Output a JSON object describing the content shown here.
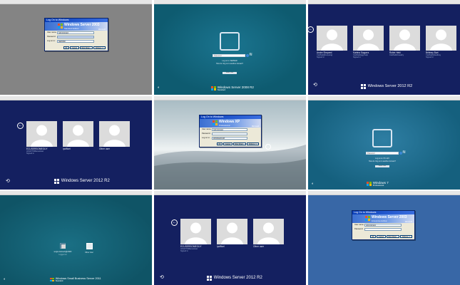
{
  "tiles": [
    {
      "title": "",
      "dialog": {
        "titlebar": "Log On to Windows",
        "brand": "Windows Server 2003",
        "edition": "Standard Edition",
        "copyright": "Microsoft",
        "fields": [
          {
            "label": "User name:",
            "value": "Administrator"
          },
          {
            "label": "Password:",
            "value": ""
          },
          {
            "label": "Log on to:",
            "value": "SERVER"
          }
        ],
        "buttons": [
          "OK",
          "Cancel",
          "Shut Down...",
          "Options <<"
        ]
      }
    },
    {
      "title": "",
      "field_placeholder": "Password",
      "links": [
        "Log on to: SERVER",
        "How do I log on to another domain?"
      ],
      "button": "Switch User",
      "brand": "Windows Server 2008 R2",
      "edition": "Standard"
    },
    {
      "title": "",
      "users": [
        {
          "name": "Andre Sheperd",
          "sub": "Cssffwddjfmeyerqq",
          "status": "Signed in"
        },
        {
          "name": "Katrina Sagurra",
          "sub": "Cssffwdsfggytnejk",
          "status": "Signed in"
        },
        {
          "name": "Robin Hebl",
          "sub": "Cssffwddrneeaby",
          "status": ""
        },
        {
          "name": "Brittney Burt",
          "sub": "Cssffwddyfwelkwy",
          "status": "Signed in"
        }
      ],
      "brand": "Windows Server 2012 R2"
    },
    {
      "title": "",
      "users": [
        {
          "name": "ECUSERSOMEGUY",
          "sub": "HOLDTOManualuser",
          "status": "Signed in"
        },
        {
          "name": "ipofficel",
          "sub": "",
          "status": ""
        },
        {
          "name": "Other user",
          "sub": "",
          "status": ""
        }
      ],
      "brand": "Windows Server 2012 R2"
    },
    {
      "title": "",
      "dialog": {
        "titlebar": "Log On to Windows",
        "brand": "Windows XP",
        "edition": "Professional",
        "copyright": "Microsoft",
        "fields": [
          {
            "label": "User name:",
            "value": "Administrator"
          },
          {
            "label": "Password:",
            "value": ""
          },
          {
            "label": "Log on to:",
            "value": "WORKGROUP"
          }
        ],
        "buttons": [
          "OK",
          "Cancel",
          "Shut Down...",
          "Options <<"
        ]
      }
    },
    {
      "title": "",
      "field_placeholder": "Password",
      "links": [
        "Log on to: PC-123",
        "How do I log on to another domain?"
      ],
      "button": "Switch User",
      "brand": "Windows 7",
      "edition": "Professional"
    },
    {
      "title": "",
      "accounts": [
        {
          "name": "sergio.deboeck@ASDF",
          "sub": "Logged on"
        },
        {
          "name": "Other User",
          "sub": ""
        }
      ],
      "brand": "Windows Small Business Server 2011",
      "edition": "Standard"
    },
    {
      "title": "",
      "users": [
        {
          "name": "ECUSERSOMEGUY",
          "sub": "HOLDTOManualuser",
          "status": "Signed in"
        },
        {
          "name": "ipofficel",
          "sub": "",
          "status": ""
        },
        {
          "name": "Other user",
          "sub": "",
          "status": ""
        }
      ],
      "brand": "Windows Server 2012 R2"
    },
    {
      "title": "",
      "dialog": {
        "titlebar": "Log On to Windows",
        "brand": "Windows Server 2003",
        "edition": "Enterprise Edition",
        "copyright": "Microsoft",
        "fields": [
          {
            "label": "User name:",
            "value": "Administrator"
          },
          {
            "label": "Password:",
            "value": ""
          }
        ],
        "buttons": [
          "OK",
          "Cancel",
          "Shut Down...",
          "Options >>"
        ]
      }
    }
  ],
  "colors": {
    "gray_bg": "#848484",
    "teal_bg": "#0e5b70",
    "navy_bg": "#142060",
    "xp_sky": "#b9c8cf",
    "blue_bg": "#3867a6",
    "titlebar": "#e7e7e7"
  }
}
